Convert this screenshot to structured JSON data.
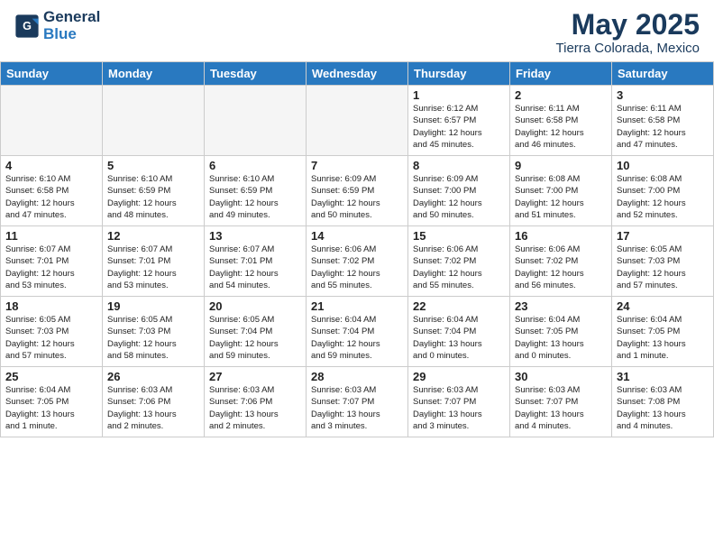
{
  "header": {
    "logo_line1": "General",
    "logo_line2": "Blue",
    "title": "May 2025",
    "subtitle": "Tierra Colorada, Mexico"
  },
  "weekdays": [
    "Sunday",
    "Monday",
    "Tuesday",
    "Wednesday",
    "Thursday",
    "Friday",
    "Saturday"
  ],
  "weeks": [
    [
      {
        "day": "",
        "info": "",
        "empty": true
      },
      {
        "day": "",
        "info": "",
        "empty": true
      },
      {
        "day": "",
        "info": "",
        "empty": true
      },
      {
        "day": "",
        "info": "",
        "empty": true
      },
      {
        "day": "1",
        "info": "Sunrise: 6:12 AM\nSunset: 6:57 PM\nDaylight: 12 hours\nand 45 minutes."
      },
      {
        "day": "2",
        "info": "Sunrise: 6:11 AM\nSunset: 6:58 PM\nDaylight: 12 hours\nand 46 minutes."
      },
      {
        "day": "3",
        "info": "Sunrise: 6:11 AM\nSunset: 6:58 PM\nDaylight: 12 hours\nand 47 minutes."
      }
    ],
    [
      {
        "day": "4",
        "info": "Sunrise: 6:10 AM\nSunset: 6:58 PM\nDaylight: 12 hours\nand 47 minutes."
      },
      {
        "day": "5",
        "info": "Sunrise: 6:10 AM\nSunset: 6:59 PM\nDaylight: 12 hours\nand 48 minutes."
      },
      {
        "day": "6",
        "info": "Sunrise: 6:10 AM\nSunset: 6:59 PM\nDaylight: 12 hours\nand 49 minutes."
      },
      {
        "day": "7",
        "info": "Sunrise: 6:09 AM\nSunset: 6:59 PM\nDaylight: 12 hours\nand 50 minutes."
      },
      {
        "day": "8",
        "info": "Sunrise: 6:09 AM\nSunset: 7:00 PM\nDaylight: 12 hours\nand 50 minutes."
      },
      {
        "day": "9",
        "info": "Sunrise: 6:08 AM\nSunset: 7:00 PM\nDaylight: 12 hours\nand 51 minutes."
      },
      {
        "day": "10",
        "info": "Sunrise: 6:08 AM\nSunset: 7:00 PM\nDaylight: 12 hours\nand 52 minutes."
      }
    ],
    [
      {
        "day": "11",
        "info": "Sunrise: 6:07 AM\nSunset: 7:01 PM\nDaylight: 12 hours\nand 53 minutes."
      },
      {
        "day": "12",
        "info": "Sunrise: 6:07 AM\nSunset: 7:01 PM\nDaylight: 12 hours\nand 53 minutes."
      },
      {
        "day": "13",
        "info": "Sunrise: 6:07 AM\nSunset: 7:01 PM\nDaylight: 12 hours\nand 54 minutes."
      },
      {
        "day": "14",
        "info": "Sunrise: 6:06 AM\nSunset: 7:02 PM\nDaylight: 12 hours\nand 55 minutes."
      },
      {
        "day": "15",
        "info": "Sunrise: 6:06 AM\nSunset: 7:02 PM\nDaylight: 12 hours\nand 55 minutes."
      },
      {
        "day": "16",
        "info": "Sunrise: 6:06 AM\nSunset: 7:02 PM\nDaylight: 12 hours\nand 56 minutes."
      },
      {
        "day": "17",
        "info": "Sunrise: 6:05 AM\nSunset: 7:03 PM\nDaylight: 12 hours\nand 57 minutes."
      }
    ],
    [
      {
        "day": "18",
        "info": "Sunrise: 6:05 AM\nSunset: 7:03 PM\nDaylight: 12 hours\nand 57 minutes."
      },
      {
        "day": "19",
        "info": "Sunrise: 6:05 AM\nSunset: 7:03 PM\nDaylight: 12 hours\nand 58 minutes."
      },
      {
        "day": "20",
        "info": "Sunrise: 6:05 AM\nSunset: 7:04 PM\nDaylight: 12 hours\nand 59 minutes."
      },
      {
        "day": "21",
        "info": "Sunrise: 6:04 AM\nSunset: 7:04 PM\nDaylight: 12 hours\nand 59 minutes."
      },
      {
        "day": "22",
        "info": "Sunrise: 6:04 AM\nSunset: 7:04 PM\nDaylight: 13 hours\nand 0 minutes."
      },
      {
        "day": "23",
        "info": "Sunrise: 6:04 AM\nSunset: 7:05 PM\nDaylight: 13 hours\nand 0 minutes."
      },
      {
        "day": "24",
        "info": "Sunrise: 6:04 AM\nSunset: 7:05 PM\nDaylight: 13 hours\nand 1 minute."
      }
    ],
    [
      {
        "day": "25",
        "info": "Sunrise: 6:04 AM\nSunset: 7:05 PM\nDaylight: 13 hours\nand 1 minute."
      },
      {
        "day": "26",
        "info": "Sunrise: 6:03 AM\nSunset: 7:06 PM\nDaylight: 13 hours\nand 2 minutes."
      },
      {
        "day": "27",
        "info": "Sunrise: 6:03 AM\nSunset: 7:06 PM\nDaylight: 13 hours\nand 2 minutes."
      },
      {
        "day": "28",
        "info": "Sunrise: 6:03 AM\nSunset: 7:07 PM\nDaylight: 13 hours\nand 3 minutes."
      },
      {
        "day": "29",
        "info": "Sunrise: 6:03 AM\nSunset: 7:07 PM\nDaylight: 13 hours\nand 3 minutes."
      },
      {
        "day": "30",
        "info": "Sunrise: 6:03 AM\nSunset: 7:07 PM\nDaylight: 13 hours\nand 4 minutes."
      },
      {
        "day": "31",
        "info": "Sunrise: 6:03 AM\nSunset: 7:08 PM\nDaylight: 13 hours\nand 4 minutes."
      }
    ]
  ]
}
